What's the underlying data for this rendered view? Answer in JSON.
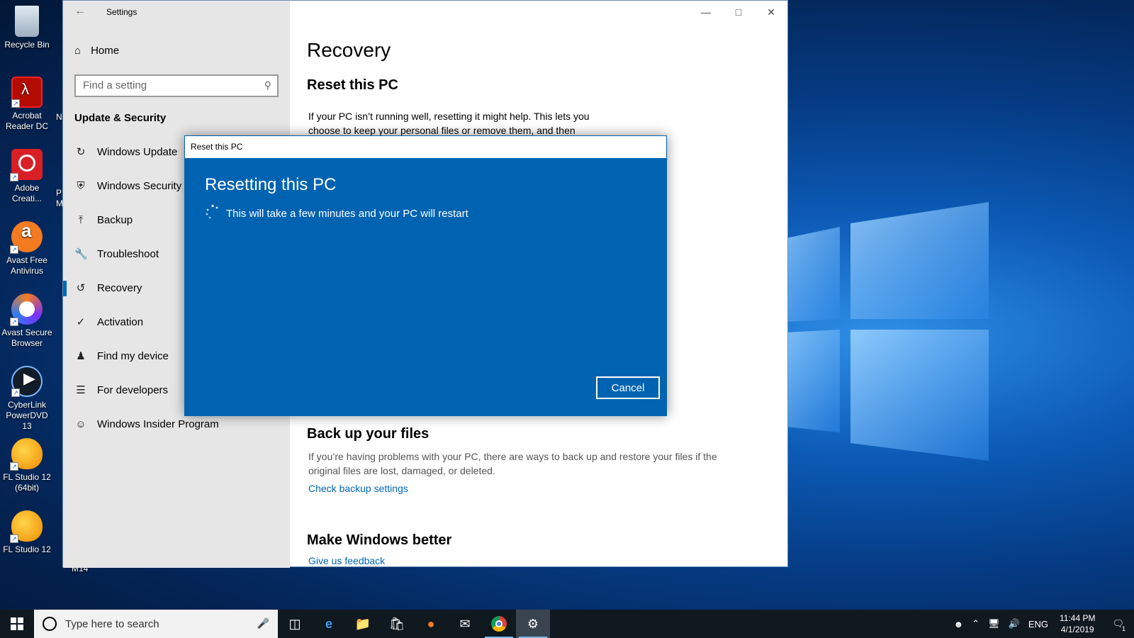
{
  "desktop": {
    "icons": [
      {
        "label": "Recycle Bin",
        "icon": "recycle-bin-icon"
      },
      {
        "label": "Acrobat Reader DC",
        "icon": "acrobat-icon"
      },
      {
        "label": "Adobe Creati...",
        "icon": "adobe-cc-icon"
      },
      {
        "label": "Avast Free Antivirus",
        "icon": "avast-icon"
      },
      {
        "label": "Avast Secure Browser",
        "icon": "avast-browser-icon"
      },
      {
        "label": "CyberLink PowerDVD 13",
        "icon": "powerdvd-icon"
      },
      {
        "label": "FL Studio 12 (64bit)",
        "icon": "fl-studio-icon"
      },
      {
        "label": "FL Studio 12",
        "icon": "fl-studio-icon"
      }
    ],
    "cut_labels": [
      "N",
      "P",
      "M",
      "M14"
    ]
  },
  "settings_window": {
    "title": "Settings",
    "sidebar": {
      "home_label": "Home",
      "search_placeholder": "Find a setting",
      "section_heading": "Update & Security",
      "items": [
        {
          "label": "Windows Update",
          "icon": "refresh-icon"
        },
        {
          "label": "Windows Security",
          "icon": "shield-icon"
        },
        {
          "label": "Backup",
          "icon": "upload-arrow-icon"
        },
        {
          "label": "Troubleshoot",
          "icon": "wrench-icon"
        },
        {
          "label": "Recovery",
          "icon": "history-icon",
          "selected": true
        },
        {
          "label": "Activation",
          "icon": "check-circle-icon"
        },
        {
          "label": "Find my device",
          "icon": "person-location-icon"
        },
        {
          "label": "For developers",
          "icon": "developer-icon"
        },
        {
          "label": "Windows Insider Program",
          "icon": "insider-cat-icon"
        }
      ]
    },
    "content": {
      "page_title": "Recovery",
      "reset": {
        "heading": "Reset this PC",
        "desc": "If your PC isn’t running well, resetting it might help. This lets you choose to keep your personal files or remove them, and then"
      },
      "backup": {
        "heading": "Back up your files",
        "desc": "If you’re having problems with your PC, there are ways to back up and restore your files if the original files are lost, damaged, or deleted.",
        "link": "Check backup settings"
      },
      "better": {
        "heading": "Make Windows better",
        "link": "Give us feedback"
      }
    }
  },
  "dialog": {
    "title": "Reset this PC",
    "heading": "Resetting this PC",
    "message": "This will take a few minutes and your PC will restart",
    "cancel_label": "Cancel"
  },
  "taskbar": {
    "search_placeholder": "Type here to search",
    "apps": [
      "task-view-icon",
      "edge-icon",
      "file-explorer-icon",
      "store-icon",
      "avast-browser-icon",
      "mail-icon",
      "chrome-icon",
      "settings-gear-icon"
    ],
    "language": "ENG",
    "time": "11:44 PM",
    "date": "4/1/2019",
    "notification_count": "1"
  },
  "colors": {
    "accent": "#0067b8",
    "dialog_bg": "#0063b1",
    "taskbar_bg": "#101820"
  }
}
